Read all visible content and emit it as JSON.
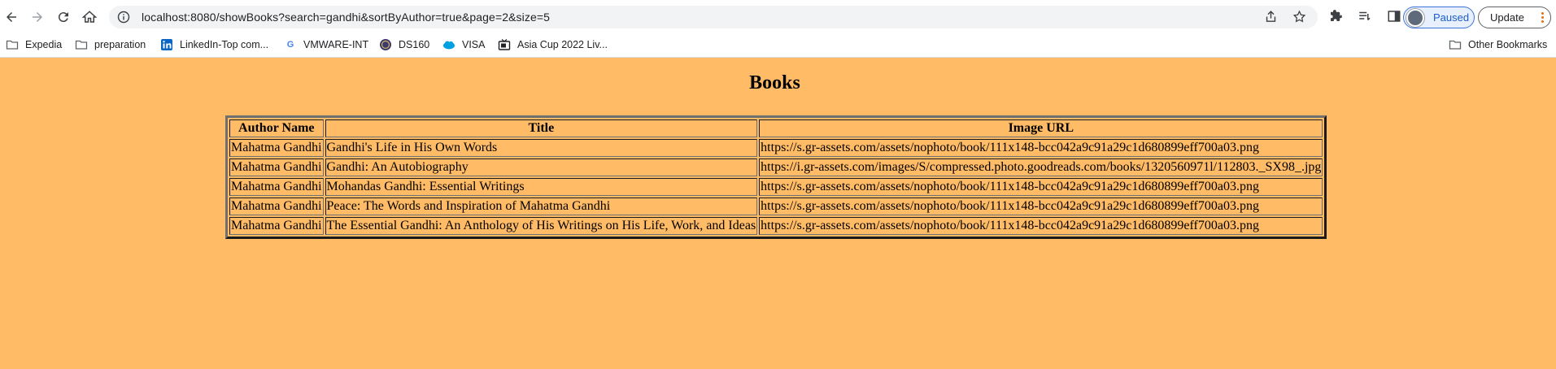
{
  "browser": {
    "url": "localhost:8080/showBooks?search=gandhi&sortByAuthor=true&page=2&size=5",
    "profile_status": "Paused",
    "update_label": "Update"
  },
  "bookmarks": [
    {
      "label": "Expedia",
      "icon": "folder-icon"
    },
    {
      "label": "preparation",
      "icon": "folder-icon"
    },
    {
      "label": "LinkedIn-Top com...",
      "icon": "linkedin-icon"
    },
    {
      "label": "VMWARE-INT",
      "icon": "google-icon"
    },
    {
      "label": "DS160",
      "icon": "seal-icon"
    },
    {
      "label": "VISA",
      "icon": "salesforce-icon"
    },
    {
      "label": "Asia Cup 2022 Liv...",
      "icon": "tv-icon"
    }
  ],
  "other_bookmarks": "Other Bookmarks",
  "page": {
    "title": "Books",
    "columns": [
      "Author Name",
      "Title",
      "Image URL"
    ],
    "rows": [
      [
        "Mahatma Gandhi",
        "Gandhi's Life in His Own Words",
        "https://s.gr-assets.com/assets/nophoto/book/111x148-bcc042a9c91a29c1d680899eff700a03.png"
      ],
      [
        "Mahatma Gandhi",
        "Gandhi: An Autobiography",
        "https://i.gr-assets.com/images/S/compressed.photo.goodreads.com/books/1320560971l/112803._SX98_.jpg"
      ],
      [
        "Mahatma Gandhi",
        "Mohandas Gandhi: Essential Writings",
        "https://s.gr-assets.com/assets/nophoto/book/111x148-bcc042a9c91a29c1d680899eff700a03.png"
      ],
      [
        "Mahatma Gandhi",
        "Peace: The Words and Inspiration of Mahatma Gandhi",
        "https://s.gr-assets.com/assets/nophoto/book/111x148-bcc042a9c91a29c1d680899eff700a03.png"
      ],
      [
        "Mahatma Gandhi",
        "The Essential Gandhi: An Anthology of His Writings on His Life, Work, and Ideas",
        "https://s.gr-assets.com/assets/nophoto/book/111x148-bcc042a9c91a29c1d680899eff700a03.png"
      ]
    ]
  },
  "colors": {
    "page_background": "#ffbb66",
    "paused_accent": "#1a5ec9"
  }
}
